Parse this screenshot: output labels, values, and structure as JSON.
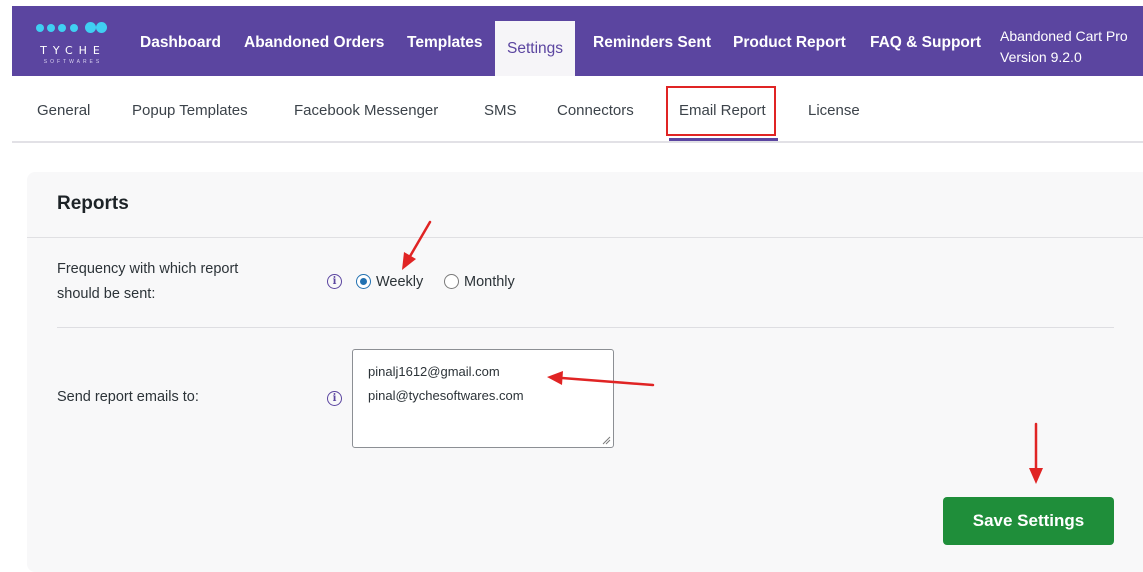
{
  "brand": {
    "name": "TYCHE",
    "sub": "SOFTWARES"
  },
  "nav": {
    "items": [
      "Dashboard",
      "Abandoned Orders",
      "Templates",
      "Settings",
      "Reminders Sent",
      "Product Report",
      "FAQ & Support"
    ],
    "active": "Settings",
    "version_line1": "Abandoned Cart Pro",
    "version_line2": "Version 9.2.0"
  },
  "tabs": {
    "items": [
      "General",
      "Popup Templates",
      "Facebook Messenger",
      "SMS",
      "Connectors",
      "Email Report",
      "License"
    ],
    "active": "Email Report"
  },
  "reports": {
    "title": "Reports",
    "frequency_label_line1": "Frequency with which report",
    "frequency_label_line2": "should be sent:",
    "options": [
      "Weekly",
      "Monthly"
    ],
    "selected": "Weekly",
    "emails_label": "Send report emails to:",
    "emails": [
      "pinalj1612@gmail.com",
      "pinal@tychesoftwares.com"
    ]
  },
  "save_label": "Save Settings",
  "colors": {
    "brand_purple": "#5b45a0",
    "logo_cyan": "#3fd0f2",
    "save_green": "#1f8e3a",
    "annotation_red": "#e02424"
  }
}
